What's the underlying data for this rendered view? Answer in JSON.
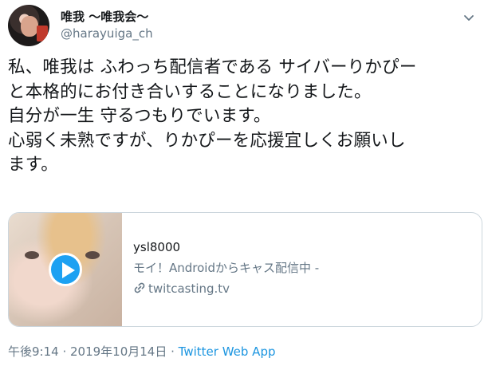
{
  "header": {
    "name": "唯我 〜唯我会〜",
    "handle": "@harayuiga_ch"
  },
  "tweet": {
    "lines": [
      "私、唯我は ふわっち配信者である サイバーりかぴー",
      "と本格的にお付き合いすることになりました。",
      "自分が一生 守るつもりでいます。",
      "心弱く未熟ですが、りかぴーを応援宜しくお願いし",
      "ます。"
    ]
  },
  "card": {
    "title": "ysl8000",
    "description": "モイ！Androidからキャス配信中 -",
    "domain": "twitcasting.tv"
  },
  "meta": {
    "time": "午後9:14",
    "sep1": " · ",
    "date": "2019年10月14日",
    "sep2": " · ",
    "app": "Twitter Web App"
  },
  "colors": {
    "accent": "#1da1f2",
    "link": "#1b95e0",
    "secondary_text": "#657786"
  }
}
